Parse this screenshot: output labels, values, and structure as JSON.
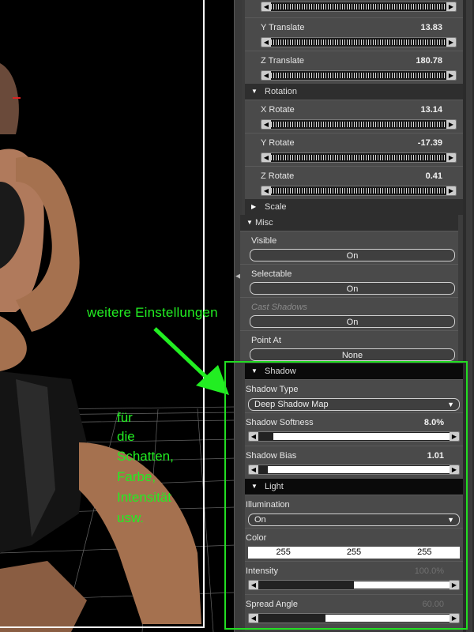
{
  "annotations": {
    "main": "weitere Einstellungen",
    "side_lines": [
      "für",
      "die",
      "Schatten,",
      "Farbe,",
      "Intensität",
      "usw."
    ]
  },
  "properties": {
    "y_translate": {
      "label": "Y Translate",
      "value": "13.83"
    },
    "z_translate": {
      "label": "Z Translate",
      "value": "180.78"
    },
    "rotation_section": "Rotation",
    "x_rotate": {
      "label": "X Rotate",
      "value": "13.14"
    },
    "y_rotate": {
      "label": "Y Rotate",
      "value": "-17.39"
    },
    "z_rotate": {
      "label": "Z Rotate",
      "value": "0.41"
    },
    "scale_section": "Scale",
    "misc_section": "Misc",
    "visible": {
      "label": "Visible",
      "value": "On"
    },
    "selectable": {
      "label": "Selectable",
      "value": "On"
    },
    "cast_shadows": {
      "label": "Cast Shadows",
      "value": "On"
    },
    "point_at": {
      "label": "Point At",
      "value": "None"
    },
    "shadow_section": "Shadow",
    "shadow_type": {
      "label": "Shadow Type",
      "value": "Deep Shadow Map"
    },
    "shadow_softness": {
      "label": "Shadow Softness",
      "value": "8.0%",
      "fraction": 0.08
    },
    "shadow_bias": {
      "label": "Shadow Bias",
      "value": "1.01"
    },
    "light_section": "Light",
    "illumination": {
      "label": "Illumination",
      "value": "On"
    },
    "color": {
      "label": "Color",
      "r": "255",
      "g": "255",
      "b": "255"
    },
    "intensity": {
      "label": "Intensity",
      "value": "100.0%",
      "fraction": 0.5
    },
    "spread_angle": {
      "label": "Spread Angle",
      "value": "60.00",
      "fraction": 0.35
    }
  },
  "colors": {
    "annotation": "#22ee22",
    "highlight_frame": "#22dd22",
    "panel_bg": "#3c3c3c"
  },
  "icons": [
    "collapse-triangle-icon",
    "expand-triangle-icon",
    "slider-left-arrow-icon",
    "slider-right-arrow-icon",
    "dropdown-arrow-icon",
    "splitter-grip-icon"
  ]
}
